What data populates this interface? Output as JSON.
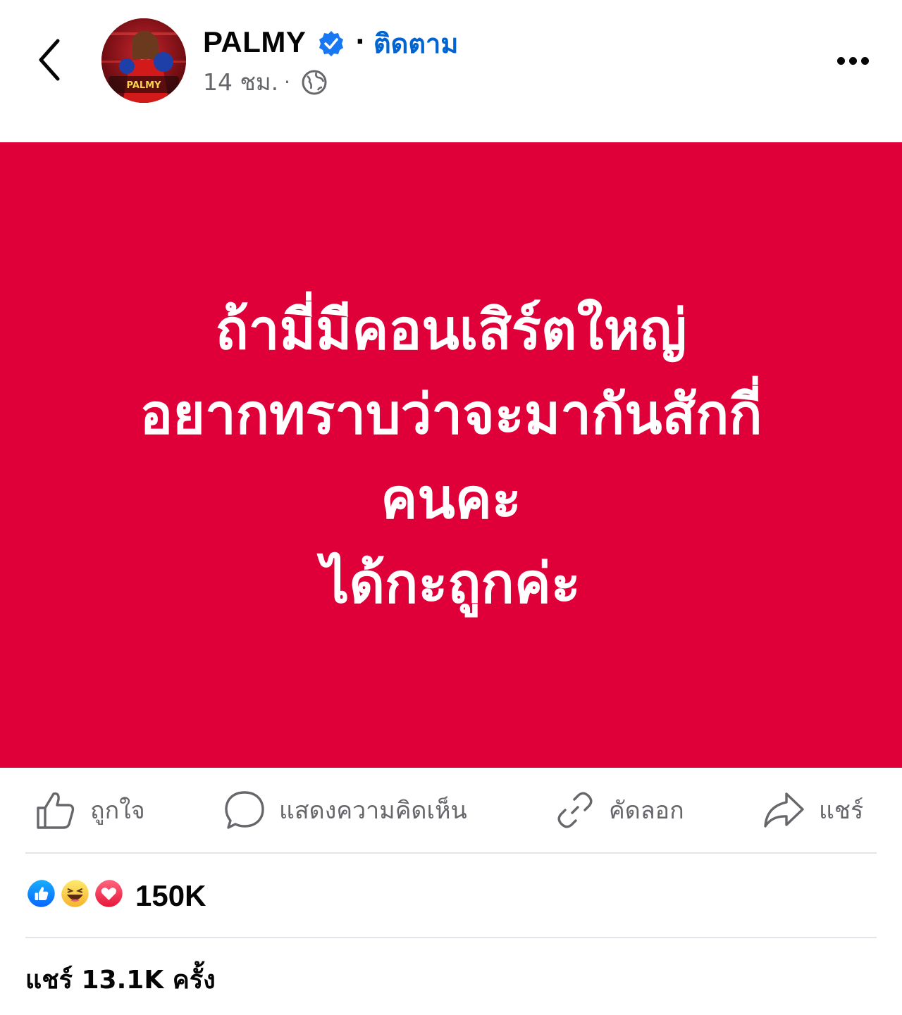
{
  "header": {
    "author_name": "PALMY",
    "separator": "·",
    "follow_label": "ติดตาม",
    "time_label": "14 ชม.",
    "time_separator": "·",
    "avatar_text": "PALMY"
  },
  "post": {
    "background_color": "#df003a",
    "lines": [
      "ถ้ามี่มีคอนเสิร์ตใหญ่",
      "อยากทราบว่าจะมากันสักกี่",
      "คนคะ",
      "ได้กะถูกค่ะ"
    ]
  },
  "actions": {
    "like_label": "ถูกใจ",
    "comment_label": "แสดงความคิดเห็น",
    "copy_label": "คัดลอก",
    "share_label": "แชร์"
  },
  "reactions": {
    "count": "150K",
    "types": [
      "like-icon",
      "haha-icon",
      "love-icon"
    ]
  },
  "shares": {
    "text": "แชร์ 13.1K ครั้ง"
  },
  "colors": {
    "link_blue": "#0064d1",
    "secondary_text": "#65676b",
    "post_red": "#df003a"
  }
}
